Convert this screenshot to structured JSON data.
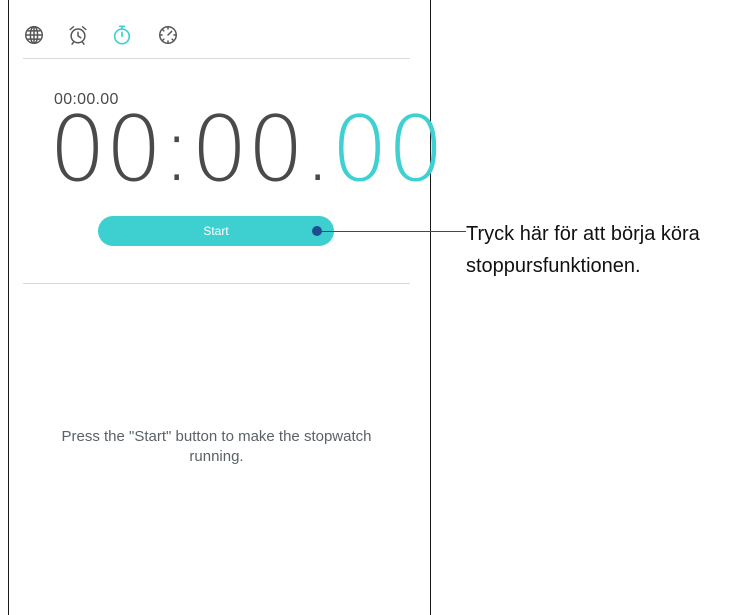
{
  "tabs": [
    {
      "name": "world-clock",
      "icon": "globe-icon",
      "active": false
    },
    {
      "name": "alarm",
      "icon": "alarm-clock-icon",
      "active": false
    },
    {
      "name": "stopwatch",
      "icon": "stopwatch-icon",
      "active": true
    },
    {
      "name": "timer",
      "icon": "timer-icon",
      "active": false
    }
  ],
  "colors": {
    "accent": "#3ed0d2",
    "icon_gray": "#555555",
    "callout": "#1f4e8c"
  },
  "stopwatch": {
    "lap_time": "00:00.00",
    "main_time": "00:00.",
    "hundredths": "00",
    "start_label": "Start",
    "hint": "Press the \"Start\" button to make the stopwatch running."
  },
  "callout": {
    "line1": "Tryck här för att börja köra",
    "line2": "stoppursfunktionen."
  }
}
